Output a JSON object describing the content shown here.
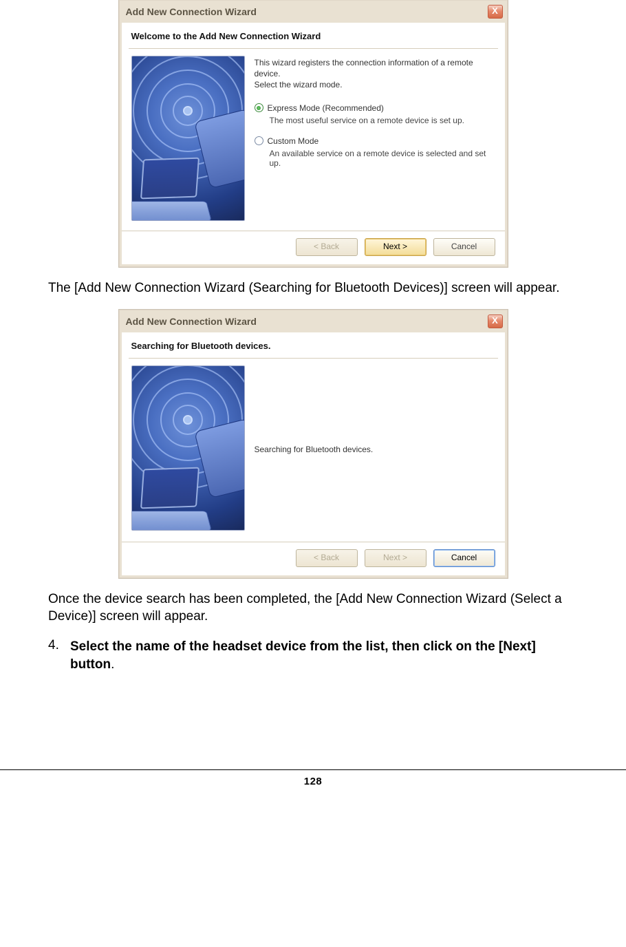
{
  "dialog1": {
    "title": "Add New Connection Wizard",
    "close_label": "X",
    "heading": "Welcome to the Add New Connection Wizard",
    "desc_line1": "This wizard registers the connection information of a remote device.",
    "desc_line2": "Select the wizard mode.",
    "option_express": {
      "label": "Express Mode (Recommended)",
      "sub": "The most useful service on a remote device is set up."
    },
    "option_custom": {
      "label": "Custom Mode",
      "sub": "An available service on a remote device is selected and set up."
    },
    "buttons": {
      "back": "< Back",
      "next": "Next >",
      "cancel": "Cancel"
    }
  },
  "para1": "The [Add New Connection Wizard (Searching for Bluetooth Devices)] screen will appear.",
  "dialog2": {
    "title": "Add New Connection Wizard",
    "close_label": "X",
    "heading": "Searching for Bluetooth devices.",
    "status": "Searching for Bluetooth devices.",
    "buttons": {
      "back": "< Back",
      "next": "Next >",
      "cancel": "Cancel"
    }
  },
  "para2": "Once the device search has been completed, the [Add New Connection Wizard (Select a Device)] screen will appear.",
  "step4": {
    "num": "4.",
    "text_bold": "Select the name of the headset device from the list, then click on the [Next] button",
    "text_tail": "."
  },
  "page_number": "128"
}
